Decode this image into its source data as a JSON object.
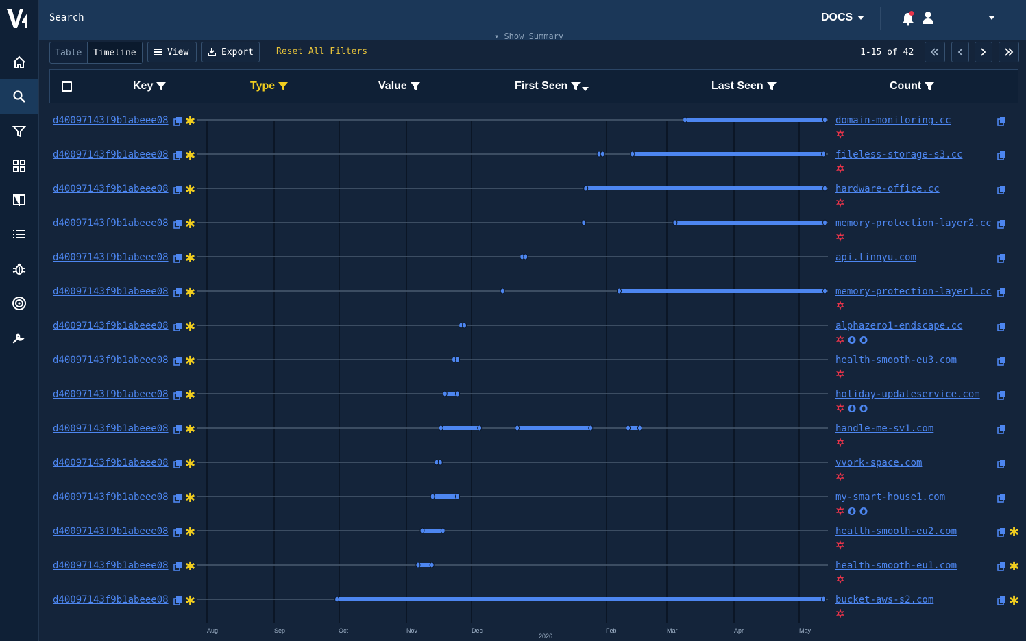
{
  "topbar": {
    "search_label": "Search",
    "summary_ghost": "▾ Show Summary",
    "docs_label": "DOCS"
  },
  "sidebar": {
    "items": [
      {
        "name": "home-icon"
      },
      {
        "name": "search-icon",
        "active": true
      },
      {
        "name": "filter-icon"
      },
      {
        "name": "dashboard-icon"
      },
      {
        "name": "compare-icon"
      },
      {
        "name": "list-icon"
      },
      {
        "name": "bug-icon"
      },
      {
        "name": "target-icon"
      },
      {
        "name": "wrench-icon"
      }
    ]
  },
  "toolbar": {
    "view_table": "Table",
    "view_timeline": "Timeline",
    "view_label": "View",
    "export_label": "Export",
    "reset_label": "Reset All Filters",
    "page_count": "1-15 of 42"
  },
  "columns": {
    "key": "Key",
    "type": "Type",
    "value": "Value",
    "first_seen": "First Seen",
    "last_seen": "Last Seen",
    "count": "Count"
  },
  "colors": {
    "accent": "#4d86f0",
    "highlight": "#f0cd1f",
    "badge_red": "#e8344a"
  },
  "timeline": {
    "months": [
      "Aug",
      "Sep",
      "Oct",
      "Nov",
      "Dec",
      "Feb",
      "Mar",
      "Apr",
      "May"
    ],
    "year_label": "2026"
  },
  "rows": [
    {
      "key": "d40097143f9b1abeee08",
      "value": "domain-monitoring.cc",
      "badges": [
        "red"
      ],
      "star_right": false,
      "spans": [
        [
          0.7734,
          0.9951
        ]
      ],
      "dots": []
    },
    {
      "key": "d40097143f9b1abeee08",
      "value": "fileless-storage-s3.cc",
      "badges": [
        "red"
      ],
      "star_right": false,
      "spans": [
        [
          0.69,
          0.993
        ]
      ],
      "dots": [
        0.6371,
        0.6426
      ]
    },
    {
      "key": "d40097143f9b1abeee08",
      "value": "hardware-office.cc",
      "badges": [
        "red"
      ],
      "star_right": false,
      "spans": [
        [
          0.616,
          0.9951
        ]
      ],
      "dots": []
    },
    {
      "key": "d40097143f9b1abeee08",
      "value": "memory-protection-layer2.cc",
      "badges": [
        "red"
      ],
      "star_right": false,
      "spans": [
        [
          0.7575,
          0.9951
        ]
      ],
      "dots": [
        0.6128
      ]
    },
    {
      "key": "d40097143f9b1abeee08",
      "value": "api.tinnyu.com",
      "badges": [],
      "star_right": false,
      "spans": [],
      "dots": [
        0.5149,
        0.5204
      ]
    },
    {
      "key": "d40097143f9b1abeee08",
      "value": "memory-protection-layer1.cc",
      "badges": [
        "red"
      ],
      "star_right": false,
      "spans": [
        [
          0.669,
          0.9951
        ]
      ],
      "dots": [
        0.4839
      ]
    },
    {
      "key": "d40097143f9b1abeee08",
      "value": "alphazero1-endscape.cc",
      "badges": [
        "red",
        "flame",
        "flame"
      ],
      "star_right": false,
      "spans": [],
      "dots": [
        0.418,
        0.4234
      ]
    },
    {
      "key": "d40097143f9b1abeee08",
      "value": "health-smooth-eu3.com",
      "badges": [
        "red"
      ],
      "star_right": false,
      "spans": [],
      "dots": [
        0.407,
        0.4125
      ]
    },
    {
      "key": "d40097143f9b1abeee08",
      "value": "holiday-updateservice.com",
      "badges": [
        "red",
        "flame",
        "flame"
      ],
      "star_right": false,
      "spans": [
        [
          0.3927,
          0.4125
        ]
      ],
      "dots": []
    },
    {
      "key": "d40097143f9b1abeee08",
      "value": "handle-me-sv1.com",
      "badges": [
        "red"
      ],
      "star_right": false,
      "spans": [
        [
          0.3862,
          0.4475
        ],
        [
          0.5072,
          0.6237
        ],
        [
          0.6832,
          0.7016
        ]
      ],
      "dots": []
    },
    {
      "key": "d40097143f9b1abeee08",
      "value": "vvork-space.com",
      "badges": [
        "red"
      ],
      "star_right": false,
      "spans": [],
      "dots": [
        0.3796,
        0.3851
      ]
    },
    {
      "key": "d40097143f9b1abeee08",
      "value": "my-smart-house1.com",
      "badges": [
        "red",
        "flame",
        "flame"
      ],
      "star_right": false,
      "spans": [
        [
          0.373,
          0.4125
        ]
      ],
      "dots": []
    },
    {
      "key": "d40097143f9b1abeee08",
      "value": "health-smooth-eu2.com",
      "badges": [
        "red"
      ],
      "star_right": true,
      "spans": [
        [
          0.3565,
          0.3895
        ]
      ],
      "dots": []
    },
    {
      "key": "d40097143f9b1abeee08",
      "value": "health-smooth-eu1.com",
      "badges": [
        "red"
      ],
      "star_right": true,
      "spans": [
        [
          0.3499,
          0.3719
        ]
      ],
      "dots": []
    },
    {
      "key": "d40097143f9b1abeee08",
      "value": "bucket-aws-s2.com",
      "badges": [
        "red"
      ],
      "star_right": true,
      "spans": [
        [
          0.2213,
          0.993
        ]
      ],
      "dots": []
    }
  ]
}
